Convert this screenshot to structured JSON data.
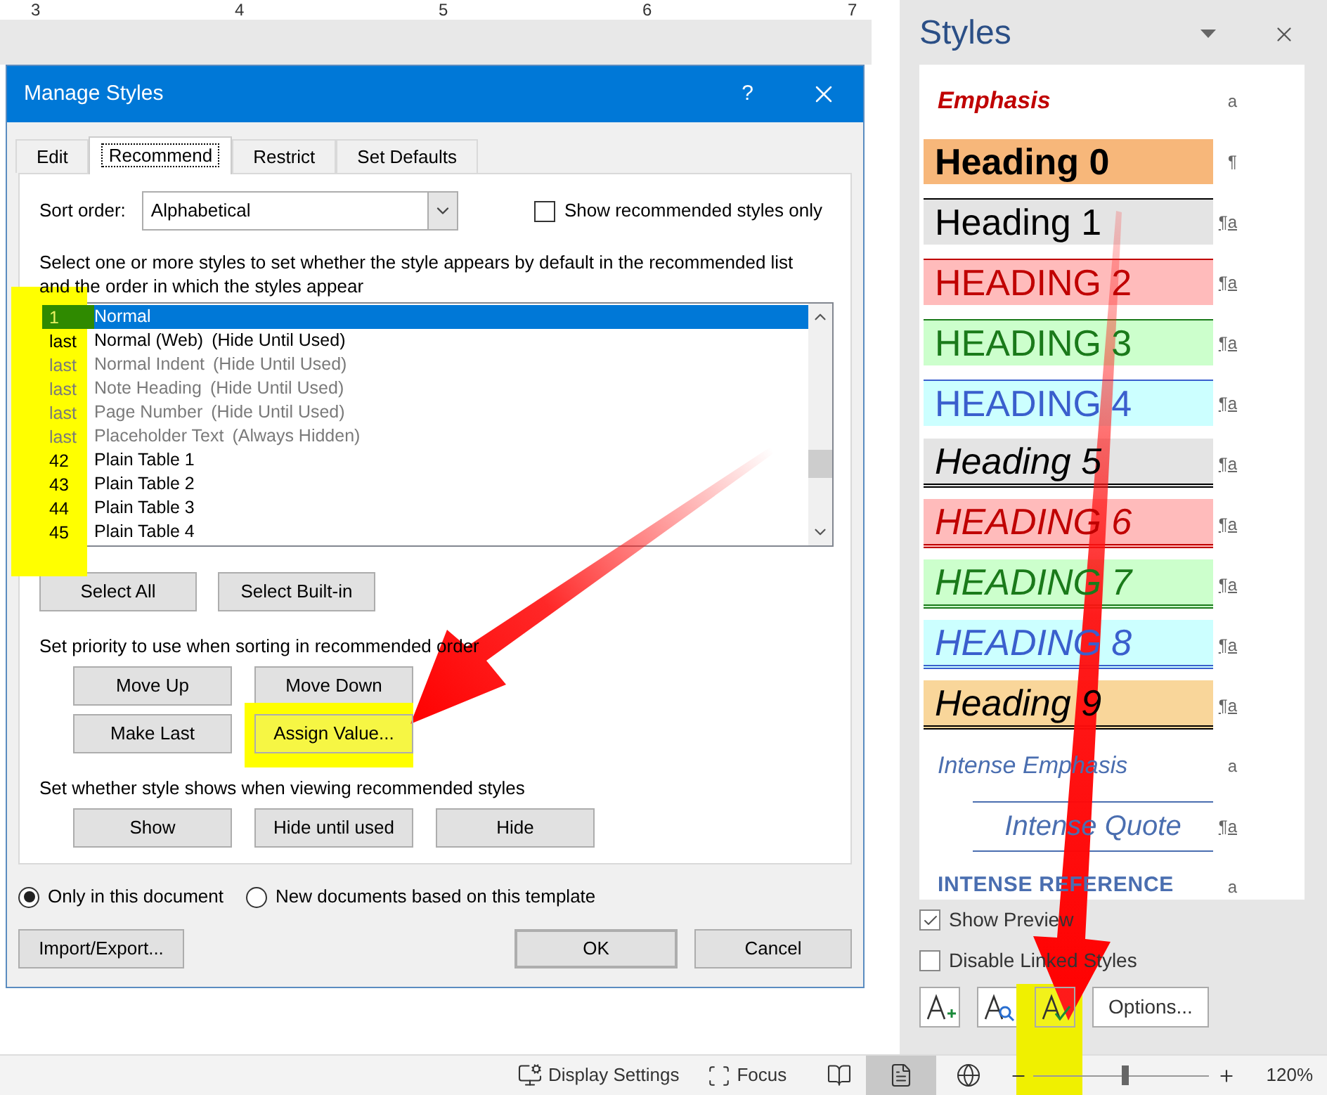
{
  "ruler": {
    "labels": [
      "3",
      "4",
      "5",
      "6",
      "7"
    ]
  },
  "dialog": {
    "title": "Manage Styles",
    "help": "?",
    "tabs": [
      {
        "label": "Edit",
        "selected": false
      },
      {
        "label": "Recommend",
        "selected": true
      },
      {
        "label": "Restrict",
        "selected": false
      },
      {
        "label": "Set Defaults",
        "selected": false
      }
    ],
    "sort_label": "Sort order:",
    "sort_value": "Alphabetical",
    "show_recommended": {
      "label": "Show recommended styles only",
      "checked": false
    },
    "instructions": "Select one or more styles to set whether the style appears by default in the recommended list and the order in which the styles appear",
    "styles": [
      {
        "priority": "1",
        "name": "Normal",
        "selected": true,
        "dimmed": false
      },
      {
        "priority": "last",
        "name": "Normal (Web)",
        "note": "(Hide Until Used)",
        "selected": false,
        "dimmed": false
      },
      {
        "priority": "last",
        "name": "Normal Indent",
        "note": "(Hide Until Used)",
        "selected": false,
        "dimmed": true
      },
      {
        "priority": "last",
        "name": "Note Heading",
        "note": "(Hide Until Used)",
        "selected": false,
        "dimmed": true
      },
      {
        "priority": "last",
        "name": "Page Number",
        "note": "(Hide Until Used)",
        "selected": false,
        "dimmed": true
      },
      {
        "priority": "last",
        "name": "Placeholder Text",
        "note": "(Always Hidden)",
        "selected": false,
        "dimmed": true
      },
      {
        "priority": "42",
        "name": "Plain Table 1",
        "selected": false,
        "dimmed": false
      },
      {
        "priority": "43",
        "name": "Plain Table 2",
        "selected": false,
        "dimmed": false
      },
      {
        "priority": "44",
        "name": "Plain Table 3",
        "selected": false,
        "dimmed": false
      },
      {
        "priority": "45",
        "name": "Plain Table 4",
        "selected": false,
        "dimmed": false
      }
    ],
    "select_buttons": [
      "Select All",
      "Select Built-in"
    ],
    "priority_label": "Set priority to use when sorting in recommended order",
    "priority_buttons": [
      "Move Up",
      "Move Down",
      "Make Last",
      "Assign Value..."
    ],
    "visibility_label": "Set whether style shows when viewing recommended styles",
    "visibility_buttons": [
      "Show",
      "Hide until used",
      "Hide"
    ],
    "scope": [
      {
        "label": "Only in this document",
        "selected": true
      },
      {
        "label": "New documents based on this template",
        "selected": false
      }
    ],
    "import_export": "Import/Export...",
    "ok": "OK",
    "cancel": "Cancel"
  },
  "styles_pane": {
    "title": "Styles",
    "items": [
      {
        "name": "Emphasis",
        "kind": "emphasis",
        "color": "#c00000",
        "marker": "a"
      },
      {
        "name": "Heading 0",
        "kind": "heading-bold",
        "color": "#000000",
        "marker": "¶"
      },
      {
        "name": "Heading 1",
        "kind": "heading",
        "color": "#000000",
        "marker": "¶a"
      },
      {
        "name": "HEADING 2",
        "kind": "heading-caps",
        "color": "#c00000",
        "marker": "¶a"
      },
      {
        "name": "HEADING 3",
        "kind": "heading-caps",
        "color": "#1a7a1a",
        "marker": "¶a"
      },
      {
        "name": "HEADING 4",
        "kind": "heading-caps",
        "color": "#3a5fcd",
        "marker": "¶a"
      },
      {
        "name": "Heading 5",
        "kind": "heading-italic",
        "color": "#000000",
        "marker": "¶a"
      },
      {
        "name": "HEADING 6",
        "kind": "heading-italic-caps",
        "color": "#c00000",
        "marker": "¶a"
      },
      {
        "name": "HEADING 7",
        "kind": "heading-italic-caps",
        "color": "#1a7a1a",
        "marker": "¶a"
      },
      {
        "name": "HEADING 8",
        "kind": "heading-italic-caps",
        "color": "#3a5fcd",
        "marker": "¶a"
      },
      {
        "name": "Heading 9",
        "kind": "heading-italic",
        "color": "#000000",
        "marker": "¶a"
      },
      {
        "name": "Intense Emphasis",
        "kind": "intense-emphasis",
        "color": "#4a6eb0",
        "marker": "a"
      },
      {
        "name": "Intense Quote",
        "kind": "intense-quote",
        "color": "#4a6eb0",
        "marker": "¶a"
      },
      {
        "name": "INTENSE REFERENCE",
        "kind": "intense-reference",
        "color": "#4a6eb0",
        "marker": "a"
      }
    ],
    "show_preview": {
      "label": "Show Preview",
      "checked": true
    },
    "disable_linked": {
      "label": "Disable Linked Styles",
      "checked": false
    },
    "options_button": "Options..."
  },
  "status_bar": {
    "display_settings": "Display Settings",
    "focus": "Focus",
    "zoom": {
      "level": 0.52,
      "reading": "120%"
    }
  }
}
